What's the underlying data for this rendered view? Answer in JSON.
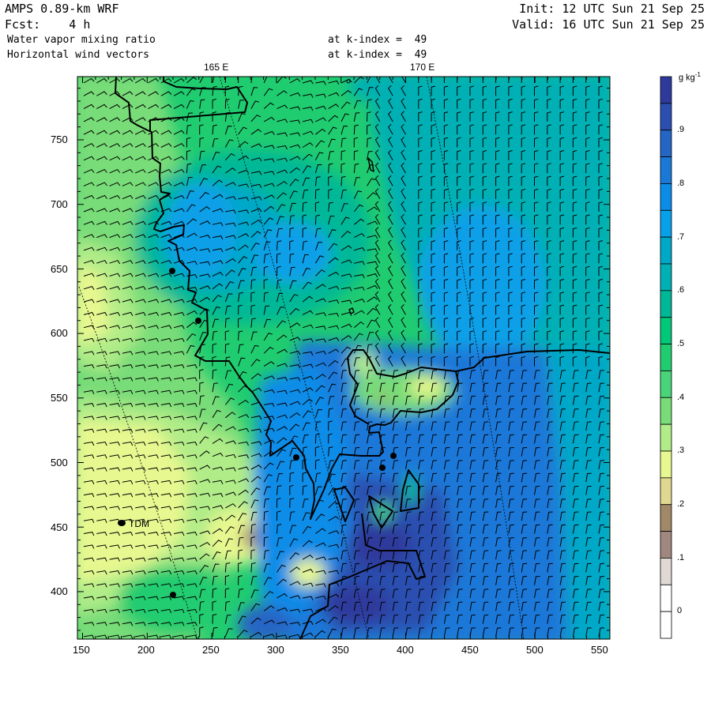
{
  "header": {
    "model": "AMPS 0.89-km WRF",
    "forecast": "Fcst:    4 h",
    "init": "Init: 12 UTC Sun 21 Sep 25",
    "valid": "Valid: 16 UTC Sun 21 Sep 25",
    "field1": "Water vapor mixing ratio",
    "field1_level": "at k-index =  49",
    "field2": "Horizontal wind vectors",
    "field2_level": "at k-index =  49"
  },
  "axes": {
    "x_ticks": [
      "150",
      "200",
      "250",
      "300",
      "350",
      "400",
      "450",
      "500",
      "550"
    ],
    "y_ticks": [
      "750",
      "700",
      "650",
      "600",
      "550",
      "500",
      "450",
      "400"
    ],
    "meridians": [
      "165 E",
      "170 E"
    ]
  },
  "stations": {
    "tdm_label": "TDM"
  },
  "colorbar": {
    "units": "g kg",
    "units_exp": "-1",
    "labels": [
      ".9",
      ".8",
      ".7",
      ".6",
      ".5",
      ".4",
      ".3",
      ".2",
      ".1",
      "0"
    ],
    "colors": [
      "#2d3a9c",
      "#2a4fb0",
      "#2565c5",
      "#1a78d8",
      "#0a8ce8",
      "#08a0e8",
      "#00a8c8",
      "#00b0b4",
      "#00b898",
      "#00c878",
      "#20cc70",
      "#48d478",
      "#78dc78",
      "#b0ec88",
      "#e8f890",
      "#e0d890",
      "#a08868",
      "#a08880",
      "#e0d8d4",
      "#ffffff",
      "#ffffff"
    ]
  }
}
